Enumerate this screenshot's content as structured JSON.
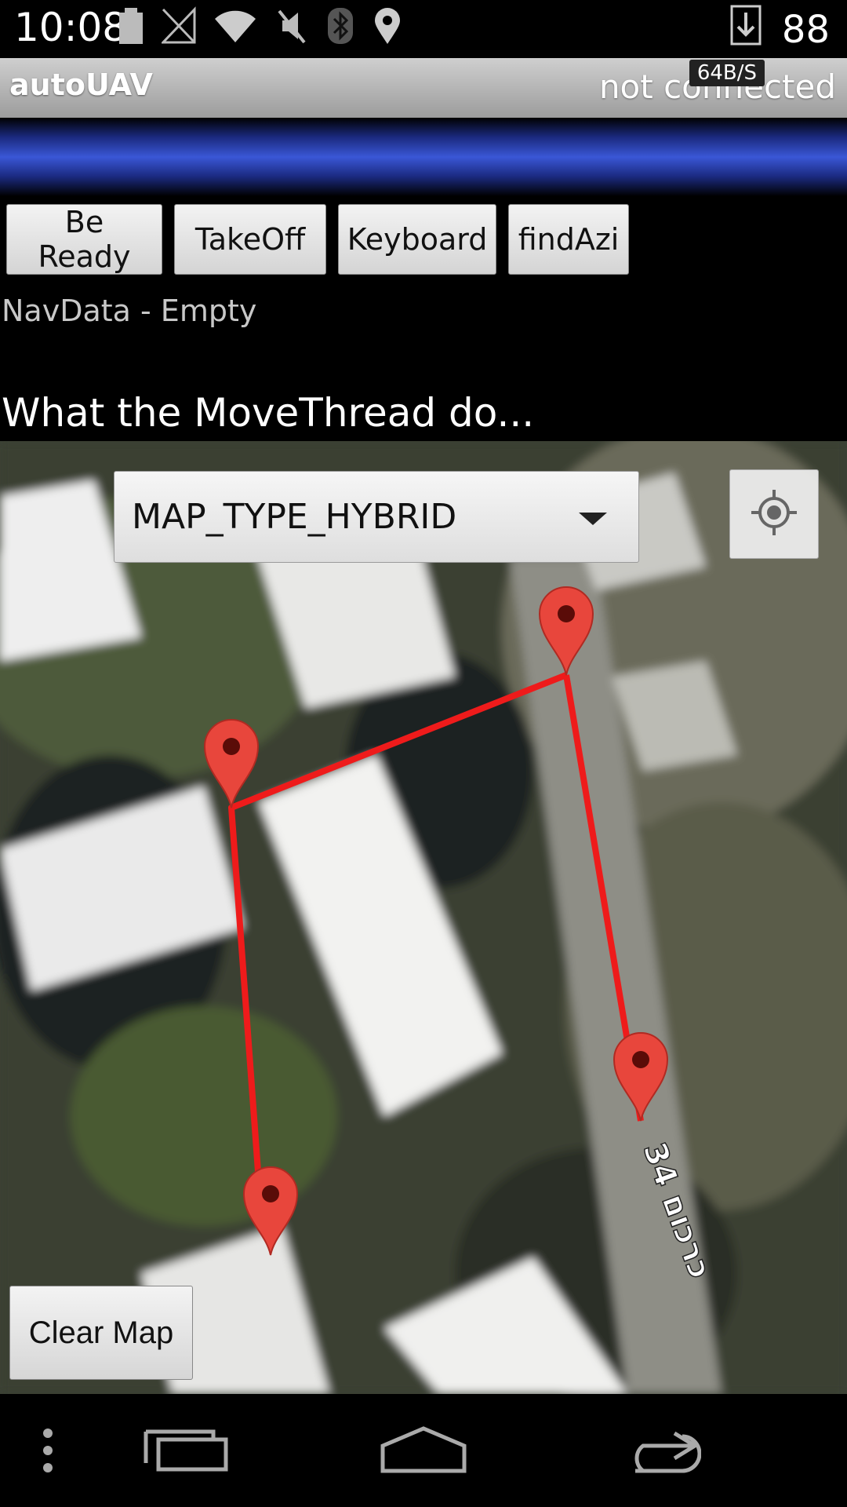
{
  "status_bar": {
    "time": "10:08",
    "battery_level": "88",
    "icons": [
      "battery-icon",
      "no-signal-icon",
      "wifi-icon",
      "mute-icon",
      "bluetooth-icon",
      "location-icon",
      "download-icon"
    ]
  },
  "app_bar": {
    "title": "autoUAV",
    "connection_status": "not connected",
    "data_rate": "64B/S"
  },
  "buttons": {
    "be_ready": "Be Ready",
    "takeoff": "TakeOff",
    "keyboard": "Keyboard",
    "find_azi": "findAzi"
  },
  "navdata_text": "NavData - Empty",
  "movethread_text": "What the MoveThread do...",
  "map": {
    "type_selected": "MAP_TYPE_HYBRID",
    "street_label": "כרכום 34",
    "markers": [
      "marker-1",
      "marker-2",
      "marker-3",
      "marker-4"
    ],
    "route_color": "#ee1b1b",
    "marker_color": "#e8463c"
  },
  "clear_map_label": "Clear Map",
  "nav_bar": {
    "icons": [
      "menu-icon",
      "recent-apps-icon",
      "home-icon",
      "back-icon"
    ]
  }
}
